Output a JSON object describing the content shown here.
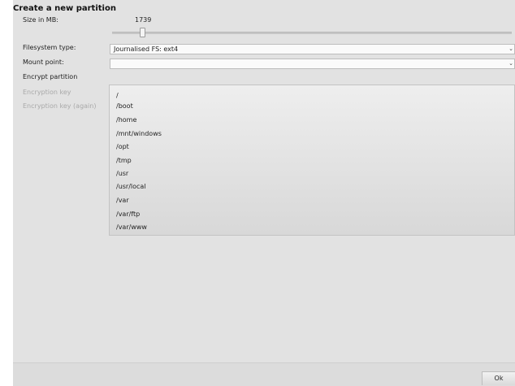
{
  "dialog": {
    "title": "Create a new partition",
    "size_label": "Size in MB:",
    "size_value": "1739",
    "filesystem_label": "Filesystem type:",
    "filesystem_value": "Journalised FS: ext4",
    "mount_label": "Mount point:",
    "mount_value": "",
    "encrypt_label": "Encrypt partition",
    "enc_key_label": "Encryption key",
    "enc_key_again_label": "Encryption key (again)",
    "ok_label": "Ok"
  },
  "mount_options": [
    "/",
    "/boot",
    "/home",
    "/mnt/windows",
    "/opt",
    "/tmp",
    "/usr",
    "/usr/local",
    "/var",
    "/var/ftp",
    "/var/www"
  ],
  "icons": {
    "combo_arrow": "chevron-down-icon"
  }
}
